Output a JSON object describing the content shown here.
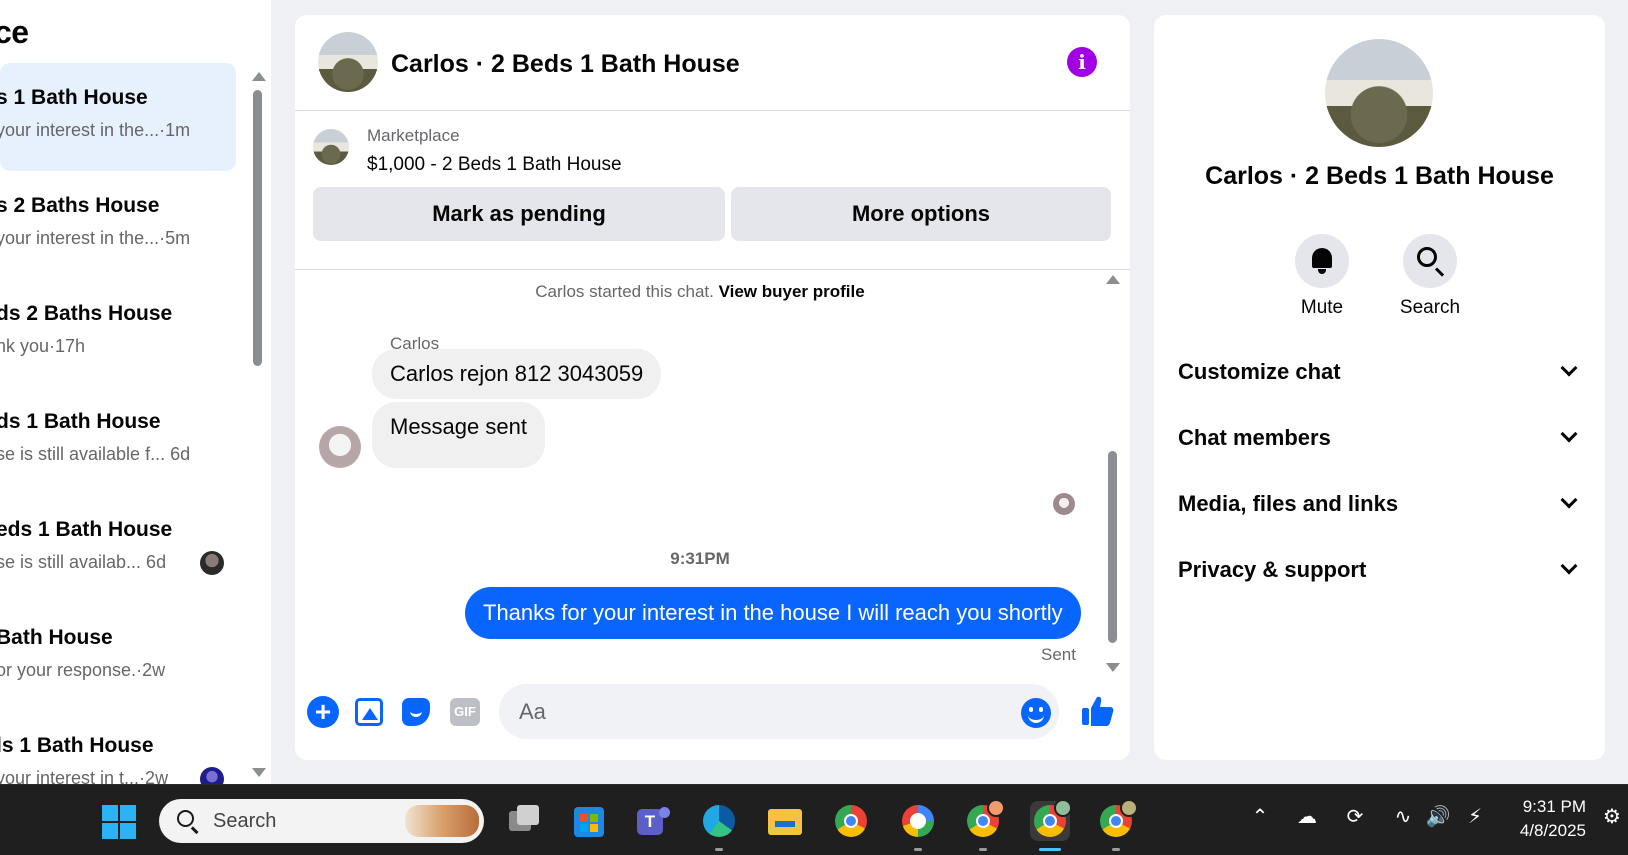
{
  "sidebar": {
    "title": "ce",
    "conversations": [
      {
        "title": "s 1 Bath House",
        "subtitle": "your interest in the...·1m",
        "active": true
      },
      {
        "title": "s 2 Baths House",
        "subtitle": "your interest in the...·5m",
        "active": false
      },
      {
        "title": "ds 2 Baths House",
        "subtitle": "nk you·17h",
        "active": false
      },
      {
        "title": "ds 1 Bath House",
        "subtitle": "se is still available f...  6d",
        "active": false
      },
      {
        "title": "eds 1 Bath House",
        "subtitle": "se is still availab...  6d",
        "active": false
      },
      {
        "title": "Bath House",
        "subtitle": "or your response.·2w",
        "active": false
      },
      {
        "title": "ls 1 Bath House",
        "subtitle": "your interest in t...·2w",
        "active": false
      }
    ]
  },
  "chat": {
    "title": "Carlos · 2 Beds 1 Bath House",
    "marketplace_label": "Marketplace",
    "listing": "$1,000 - 2 Beds 1 Bath House",
    "mark_pending_label": "Mark as pending",
    "more_options_label": "More options",
    "system_prefix": "Carlos started this chat.",
    "system_link": "View buyer profile",
    "sender_name": "Carlos",
    "incoming": [
      "Carlos rejon 812 3043059",
      "Message sent"
    ],
    "timestamp": "9:31PM",
    "outgoing": "Thanks for your interest in the house I will reach you shortly",
    "status": "Sent",
    "input_placeholder": "Aa",
    "gif_label": "GIF"
  },
  "details": {
    "title": "Carlos · 2 Beds 1 Bath House",
    "actions": [
      {
        "label": "Mute",
        "icon": "bell-icon"
      },
      {
        "label": "Search",
        "icon": "search-icon"
      }
    ],
    "sections": [
      "Customize chat",
      "Chat members",
      "Media, files and links",
      "Privacy & support"
    ]
  },
  "taskbar": {
    "search_label": "Search",
    "time": "9:31 PM",
    "date": "4/8/2025"
  },
  "colors": {
    "accent": "#0866ff",
    "info": "#a100e6",
    "active_row": "#e7f1fd"
  }
}
